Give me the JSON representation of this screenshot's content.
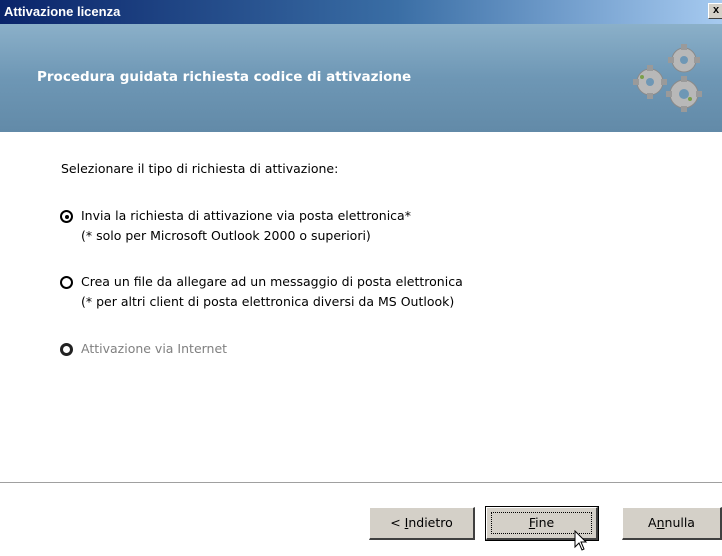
{
  "window": {
    "title": "Attivazione licenza",
    "close_label": "x"
  },
  "header": {
    "wizard_title": "Procedura guidata richiesta codice di attivazione",
    "gears_icon": "gears-icon"
  },
  "content": {
    "prompt": "Selezionare il tipo di richiesta di attivazione:",
    "options": [
      {
        "label": "Invia la richiesta di attivazione via posta elettronica*",
        "note": "(* solo per Microsoft Outlook 2000 o superiori)",
        "selected": true,
        "enabled": true
      },
      {
        "label": "Crea un file da allegare ad un messaggio di posta elettronica",
        "note": "(* per altri client di posta elettronica diversi da MS Outlook)",
        "selected": false,
        "enabled": true
      },
      {
        "label": "Attivazione via Internet",
        "note": "",
        "selected": false,
        "enabled": false
      }
    ]
  },
  "buttons": {
    "back": {
      "prefix": "< ",
      "mnemonic": "I",
      "rest": "ndietro"
    },
    "finish": {
      "prefix": "",
      "mnemonic": "F",
      "rest": "ine"
    },
    "cancel": {
      "prefix": "A",
      "mnemonic": "n",
      "rest": "nulla"
    }
  },
  "colors": {
    "header_bg": "#6e97b5",
    "titlebar_start": "#0a246a",
    "button_face": "#d4d0c8"
  }
}
